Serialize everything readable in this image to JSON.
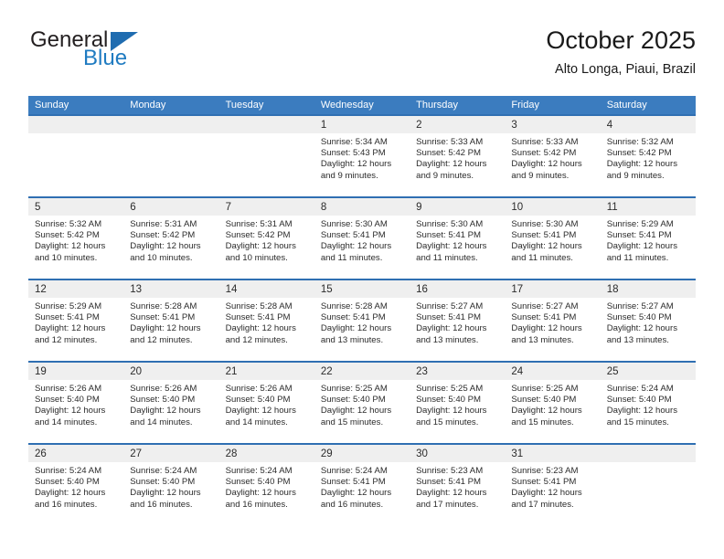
{
  "brand": {
    "name_top": "General",
    "name_bottom": "Blue",
    "color_dark": "#231f20",
    "color_blue": "#1f7bc1"
  },
  "header": {
    "title": "October 2025",
    "subtitle": "Alto Longa, Piaui, Brazil"
  },
  "theme": {
    "header_row_bg": "#3b7cbf",
    "week_border": "#2f6fb2",
    "daynum_band_bg": "#efefef",
    "text": "#2b2b2b"
  },
  "weekday_headers": [
    "Sunday",
    "Monday",
    "Tuesday",
    "Wednesday",
    "Thursday",
    "Friday",
    "Saturday"
  ],
  "weeks": [
    [
      {
        "day": "",
        "sunrise": "",
        "sunset": "",
        "daylight_line1": "",
        "daylight_line2": ""
      },
      {
        "day": "",
        "sunrise": "",
        "sunset": "",
        "daylight_line1": "",
        "daylight_line2": ""
      },
      {
        "day": "",
        "sunrise": "",
        "sunset": "",
        "daylight_line1": "",
        "daylight_line2": ""
      },
      {
        "day": "1",
        "sunrise": "Sunrise: 5:34 AM",
        "sunset": "Sunset: 5:43 PM",
        "daylight_line1": "Daylight: 12 hours",
        "daylight_line2": "and 9 minutes."
      },
      {
        "day": "2",
        "sunrise": "Sunrise: 5:33 AM",
        "sunset": "Sunset: 5:42 PM",
        "daylight_line1": "Daylight: 12 hours",
        "daylight_line2": "and 9 minutes."
      },
      {
        "day": "3",
        "sunrise": "Sunrise: 5:33 AM",
        "sunset": "Sunset: 5:42 PM",
        "daylight_line1": "Daylight: 12 hours",
        "daylight_line2": "and 9 minutes."
      },
      {
        "day": "4",
        "sunrise": "Sunrise: 5:32 AM",
        "sunset": "Sunset: 5:42 PM",
        "daylight_line1": "Daylight: 12 hours",
        "daylight_line2": "and 9 minutes."
      }
    ],
    [
      {
        "day": "5",
        "sunrise": "Sunrise: 5:32 AM",
        "sunset": "Sunset: 5:42 PM",
        "daylight_line1": "Daylight: 12 hours",
        "daylight_line2": "and 10 minutes."
      },
      {
        "day": "6",
        "sunrise": "Sunrise: 5:31 AM",
        "sunset": "Sunset: 5:42 PM",
        "daylight_line1": "Daylight: 12 hours",
        "daylight_line2": "and 10 minutes."
      },
      {
        "day": "7",
        "sunrise": "Sunrise: 5:31 AM",
        "sunset": "Sunset: 5:42 PM",
        "daylight_line1": "Daylight: 12 hours",
        "daylight_line2": "and 10 minutes."
      },
      {
        "day": "8",
        "sunrise": "Sunrise: 5:30 AM",
        "sunset": "Sunset: 5:41 PM",
        "daylight_line1": "Daylight: 12 hours",
        "daylight_line2": "and 11 minutes."
      },
      {
        "day": "9",
        "sunrise": "Sunrise: 5:30 AM",
        "sunset": "Sunset: 5:41 PM",
        "daylight_line1": "Daylight: 12 hours",
        "daylight_line2": "and 11 minutes."
      },
      {
        "day": "10",
        "sunrise": "Sunrise: 5:30 AM",
        "sunset": "Sunset: 5:41 PM",
        "daylight_line1": "Daylight: 12 hours",
        "daylight_line2": "and 11 minutes."
      },
      {
        "day": "11",
        "sunrise": "Sunrise: 5:29 AM",
        "sunset": "Sunset: 5:41 PM",
        "daylight_line1": "Daylight: 12 hours",
        "daylight_line2": "and 11 minutes."
      }
    ],
    [
      {
        "day": "12",
        "sunrise": "Sunrise: 5:29 AM",
        "sunset": "Sunset: 5:41 PM",
        "daylight_line1": "Daylight: 12 hours",
        "daylight_line2": "and 12 minutes."
      },
      {
        "day": "13",
        "sunrise": "Sunrise: 5:28 AM",
        "sunset": "Sunset: 5:41 PM",
        "daylight_line1": "Daylight: 12 hours",
        "daylight_line2": "and 12 minutes."
      },
      {
        "day": "14",
        "sunrise": "Sunrise: 5:28 AM",
        "sunset": "Sunset: 5:41 PM",
        "daylight_line1": "Daylight: 12 hours",
        "daylight_line2": "and 12 minutes."
      },
      {
        "day": "15",
        "sunrise": "Sunrise: 5:28 AM",
        "sunset": "Sunset: 5:41 PM",
        "daylight_line1": "Daylight: 12 hours",
        "daylight_line2": "and 13 minutes."
      },
      {
        "day": "16",
        "sunrise": "Sunrise: 5:27 AM",
        "sunset": "Sunset: 5:41 PM",
        "daylight_line1": "Daylight: 12 hours",
        "daylight_line2": "and 13 minutes."
      },
      {
        "day": "17",
        "sunrise": "Sunrise: 5:27 AM",
        "sunset": "Sunset: 5:41 PM",
        "daylight_line1": "Daylight: 12 hours",
        "daylight_line2": "and 13 minutes."
      },
      {
        "day": "18",
        "sunrise": "Sunrise: 5:27 AM",
        "sunset": "Sunset: 5:40 PM",
        "daylight_line1": "Daylight: 12 hours",
        "daylight_line2": "and 13 minutes."
      }
    ],
    [
      {
        "day": "19",
        "sunrise": "Sunrise: 5:26 AM",
        "sunset": "Sunset: 5:40 PM",
        "daylight_line1": "Daylight: 12 hours",
        "daylight_line2": "and 14 minutes."
      },
      {
        "day": "20",
        "sunrise": "Sunrise: 5:26 AM",
        "sunset": "Sunset: 5:40 PM",
        "daylight_line1": "Daylight: 12 hours",
        "daylight_line2": "and 14 minutes."
      },
      {
        "day": "21",
        "sunrise": "Sunrise: 5:26 AM",
        "sunset": "Sunset: 5:40 PM",
        "daylight_line1": "Daylight: 12 hours",
        "daylight_line2": "and 14 minutes."
      },
      {
        "day": "22",
        "sunrise": "Sunrise: 5:25 AM",
        "sunset": "Sunset: 5:40 PM",
        "daylight_line1": "Daylight: 12 hours",
        "daylight_line2": "and 15 minutes."
      },
      {
        "day": "23",
        "sunrise": "Sunrise: 5:25 AM",
        "sunset": "Sunset: 5:40 PM",
        "daylight_line1": "Daylight: 12 hours",
        "daylight_line2": "and 15 minutes."
      },
      {
        "day": "24",
        "sunrise": "Sunrise: 5:25 AM",
        "sunset": "Sunset: 5:40 PM",
        "daylight_line1": "Daylight: 12 hours",
        "daylight_line2": "and 15 minutes."
      },
      {
        "day": "25",
        "sunrise": "Sunrise: 5:24 AM",
        "sunset": "Sunset: 5:40 PM",
        "daylight_line1": "Daylight: 12 hours",
        "daylight_line2": "and 15 minutes."
      }
    ],
    [
      {
        "day": "26",
        "sunrise": "Sunrise: 5:24 AM",
        "sunset": "Sunset: 5:40 PM",
        "daylight_line1": "Daylight: 12 hours",
        "daylight_line2": "and 16 minutes."
      },
      {
        "day": "27",
        "sunrise": "Sunrise: 5:24 AM",
        "sunset": "Sunset: 5:40 PM",
        "daylight_line1": "Daylight: 12 hours",
        "daylight_line2": "and 16 minutes."
      },
      {
        "day": "28",
        "sunrise": "Sunrise: 5:24 AM",
        "sunset": "Sunset: 5:40 PM",
        "daylight_line1": "Daylight: 12 hours",
        "daylight_line2": "and 16 minutes."
      },
      {
        "day": "29",
        "sunrise": "Sunrise: 5:24 AM",
        "sunset": "Sunset: 5:41 PM",
        "daylight_line1": "Daylight: 12 hours",
        "daylight_line2": "and 16 minutes."
      },
      {
        "day": "30",
        "sunrise": "Sunrise: 5:23 AM",
        "sunset": "Sunset: 5:41 PM",
        "daylight_line1": "Daylight: 12 hours",
        "daylight_line2": "and 17 minutes."
      },
      {
        "day": "31",
        "sunrise": "Sunrise: 5:23 AM",
        "sunset": "Sunset: 5:41 PM",
        "daylight_line1": "Daylight: 12 hours",
        "daylight_line2": "and 17 minutes."
      },
      {
        "day": "",
        "sunrise": "",
        "sunset": "",
        "daylight_line1": "",
        "daylight_line2": ""
      }
    ]
  ]
}
